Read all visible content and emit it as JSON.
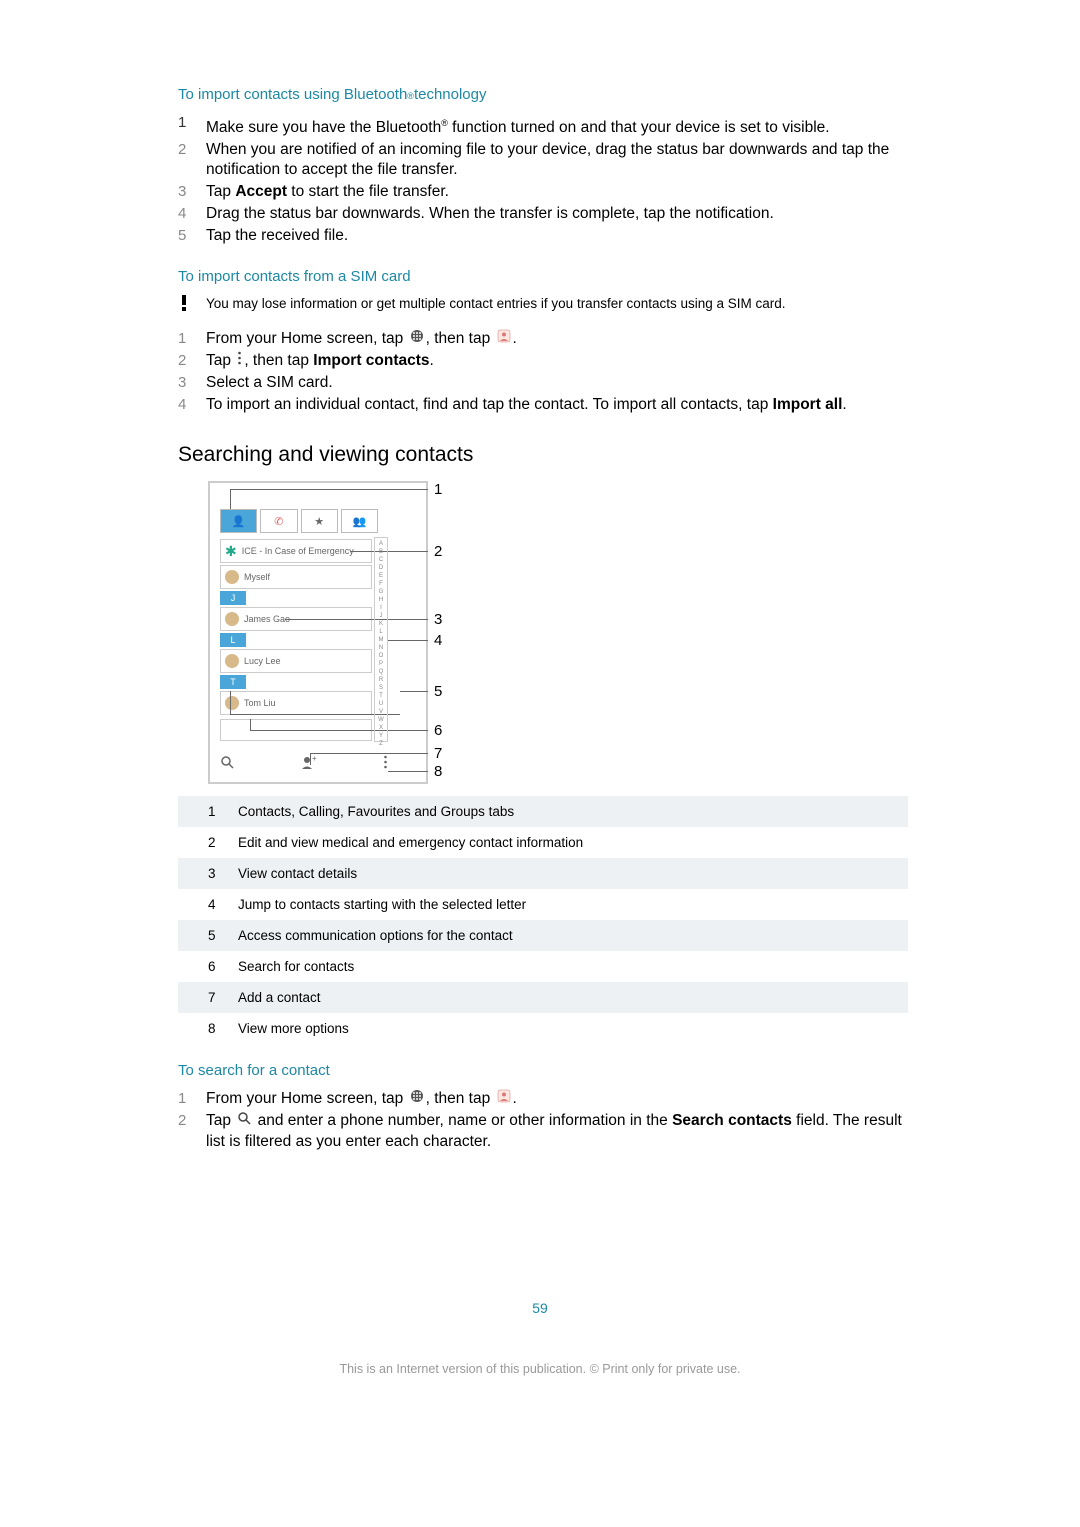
{
  "section1": {
    "title_pre": "To import contacts using Bluetooth",
    "title_post": " technology",
    "steps": [
      "Make sure you have the Bluetooth® function turned on and that your device is set to visible.",
      "When you are notified of an incoming file to your device, drag the status bar downwards and tap the notification to accept the file transfer.",
      "Tap <b>Accept</b> to start the file transfer.",
      "Drag the status bar downwards. When the transfer is complete, tap the notification.",
      "Tap the received file."
    ]
  },
  "section2": {
    "title": "To import contacts from a SIM card",
    "warning": "You may lose information or get multiple contact entries if you transfer contacts using a SIM card.",
    "steps": [
      "From your Home screen, tap {apps}, then tap {contacts}.",
      "Tap {menu}, then tap <b>Import contacts</b>.",
      "Select a SIM card.",
      "To import an individual contact, find and tap the contact. To import all contacts, tap <b>Import all</b>."
    ]
  },
  "h2": "Searching and viewing contacts",
  "diagram": {
    "ice": "ICE - In Case of Emergency",
    "me": "Myself",
    "names": [
      "James Gao",
      "Lucy Lee",
      "Tom Liu"
    ],
    "letters": [
      "J",
      "L",
      "T"
    ],
    "index_letters": [
      "A",
      "B",
      "C",
      "D",
      "E",
      "F",
      "G",
      "H",
      "I",
      "J",
      "K",
      "L",
      "M",
      "N",
      "O",
      "P",
      "Q",
      "R",
      "S",
      "T",
      "U",
      "V",
      "W",
      "X",
      "Y",
      "Z"
    ],
    "labels": [
      "1",
      "2",
      "3",
      "4",
      "5",
      "6",
      "7",
      "8"
    ]
  },
  "legend": [
    "Contacts, Calling, Favourites and Groups tabs",
    "Edit and view medical and emergency contact information",
    "View contact details",
    "Jump to contacts starting with the selected letter",
    "Access communication options for the contact",
    "Search for contacts",
    "Add a contact",
    "View more options"
  ],
  "section3": {
    "title": "To search for a contact",
    "steps": [
      "From your Home screen, tap {apps}, then tap {contacts}.",
      "Tap {search} and enter a phone number, name or other information in the <b>Search contacts</b> field. The result list is filtered as you enter each character."
    ]
  },
  "page_number": "59",
  "footer": "This is an Internet version of this publication. © Print only for private use."
}
